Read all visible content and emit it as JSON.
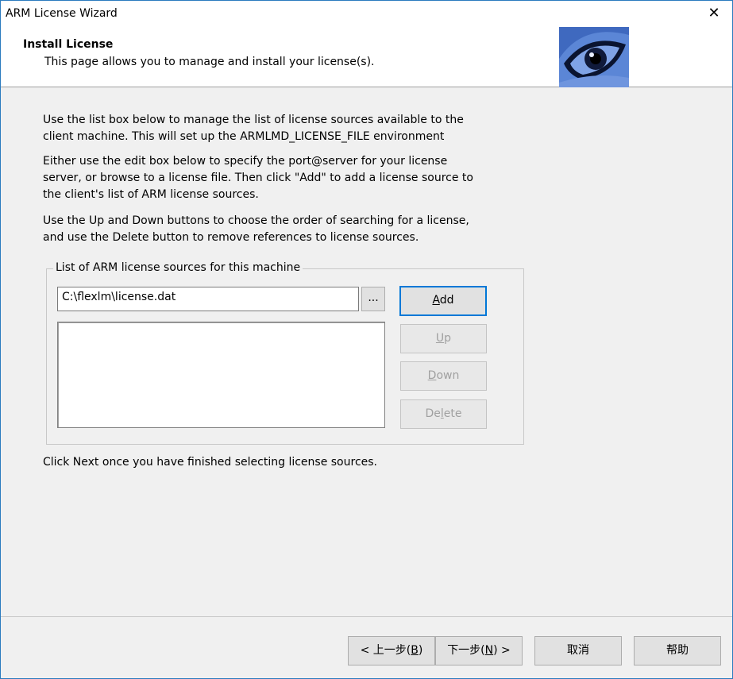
{
  "window": {
    "title": "ARM License Wizard",
    "close_glyph": "✕"
  },
  "header": {
    "title": "Install License",
    "subtitle": "This page allows you to manage and install your license(s)."
  },
  "body": {
    "para1_line1": "Use the list box below to manage the list of license sources available to the",
    "para1_line2": "client machine. This will set up the ARMLMD_LICENSE_FILE environment",
    "para2_line1": "Either use the edit box below to specify the port@server for your license",
    "para2_line2": "server, or browse to a license file. Then click \"Add\" to add a license source to",
    "para2_line3": "the client's list of ARM license sources.",
    "para3_line1": "Use the Up and Down buttons to choose the order of searching for a license,",
    "para3_line2": "and use the Delete button to remove references to license sources.",
    "finish_note": "Click Next once you have finished selecting license sources."
  },
  "group": {
    "legend": "List of ARM license sources for this machine",
    "edit_value": "C:\\flexlm\\license.dat",
    "browse_label": "...",
    "add": {
      "pre": "",
      "ul": "A",
      "post": "dd"
    },
    "up": {
      "pre": "",
      "ul": "U",
      "post": "p"
    },
    "down": {
      "pre": "",
      "ul": "D",
      "post": "own"
    },
    "delete": {
      "pre": "De",
      "ul": "l",
      "post": "ete"
    },
    "list_items": []
  },
  "footer": {
    "back": {
      "pre": "< 上一步(",
      "ul": "B",
      "post": ")"
    },
    "next": {
      "pre": "下一步(",
      "ul": "N",
      "post": ") >"
    },
    "cancel": "取消",
    "help": "帮助"
  },
  "colors": {
    "accent": "#0078d7",
    "border": "#2b7bbf",
    "disabled_text": "#a0a0a0"
  }
}
